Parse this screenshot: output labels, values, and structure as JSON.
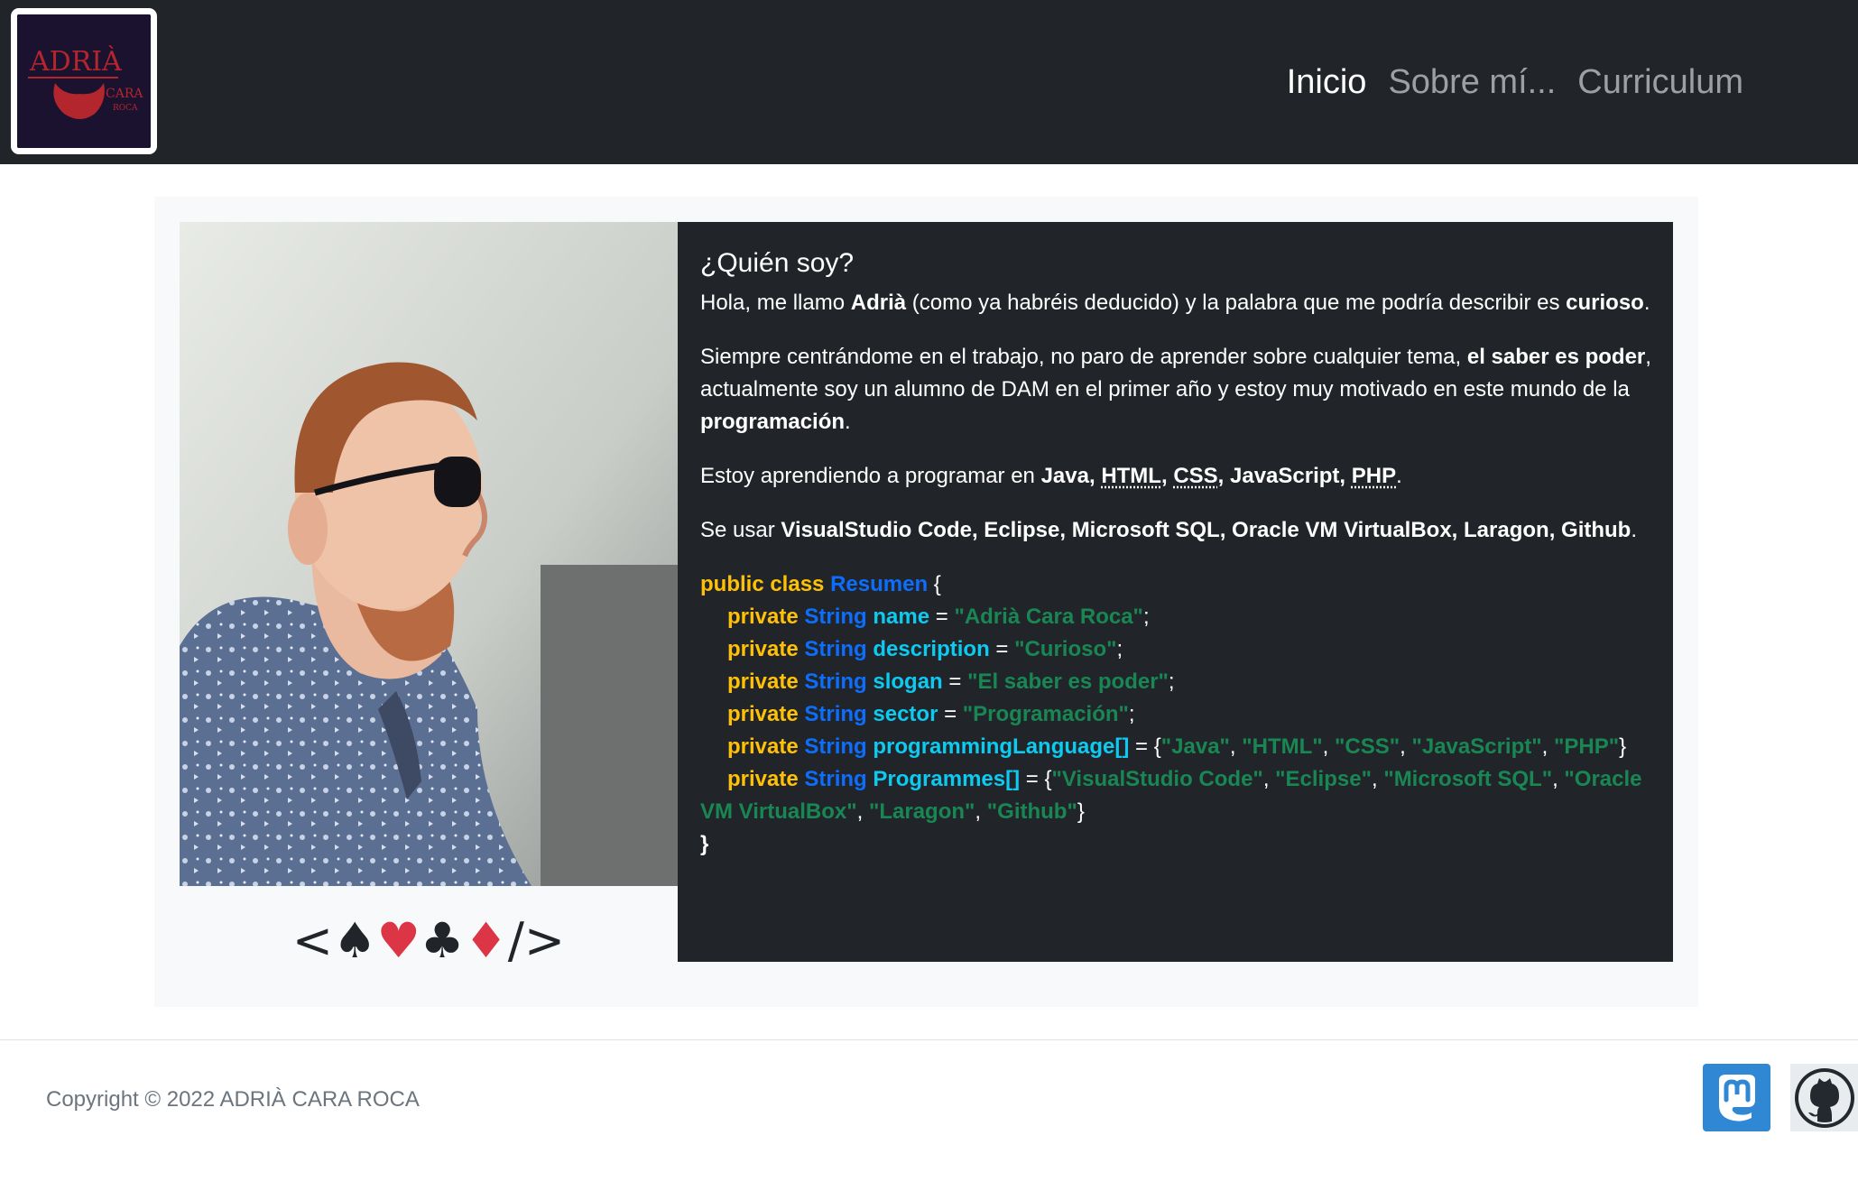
{
  "header": {
    "logo": {
      "name": "ADRIÀ",
      "sub": "CARA",
      "sub2": "ROCA",
      "alt": "Adrià Cara Roca logo"
    },
    "nav": [
      {
        "label": "Inicio",
        "active": true
      },
      {
        "label": "Sobre mí...",
        "active": false
      },
      {
        "label": "Curriculum",
        "active": false
      }
    ]
  },
  "main": {
    "photo_alt": "Adrià in profile wearing sunglasses and a patterned shirt",
    "suits": {
      "open": "<",
      "spade": "♠",
      "heart": "♥",
      "club": "♣",
      "diamond": "♦",
      "close": "/>"
    },
    "heading": "¿Quién soy?",
    "p1": {
      "a": "Hola, me llamo ",
      "name": "Adrià",
      "b": " (como ya habréis deducido) y la palabra que me podría describir es ",
      "word": "curioso",
      "c": "."
    },
    "p2": {
      "a": "Siempre centrándome en el trabajo, no paro de aprender sobre cualquier tema, ",
      "motto": "el saber es poder",
      "b": ", actualmente soy un alumno de DAM en el primer año y estoy muy motivado en este mundo de la ",
      "field": "programación",
      "c": "."
    },
    "p3": {
      "a": "Estoy aprendiendo a programar en ",
      "java": "Java",
      "html": "HTML",
      "css": "CSS",
      "js": "JavaScript",
      "php": "PHP",
      "sep": ", ",
      "end": "."
    },
    "p4": {
      "a": "Se usar ",
      "tools": "VisualStudio Code, Eclipse, Microsoft SQL, Oracle VM VirtualBox, Laragon, Github",
      "end": "."
    },
    "code": {
      "public_class": "public class",
      "class_name": "Resumen",
      "open_brace": " {",
      "private": "private",
      "type": "String",
      "eq": " = ",
      "semi": ";",
      "lb": "{",
      "rb": "}",
      "comma": ", ",
      "close_brace": "}",
      "name_field": "name",
      "name_val": "\"Adrià Cara Roca\"",
      "desc_field": "description",
      "desc_val": "\"Curioso\"",
      "slogan_field": "slogan",
      "slogan_val": "\"El saber es poder\"",
      "sector_field": "sector",
      "sector_val": "\"Programación\"",
      "lang_field": "programmingLanguage[]",
      "langs": [
        "\"Java\"",
        "\"HTML\"",
        "\"CSS\"",
        "\"JavaScript\"",
        "\"PHP\""
      ],
      "prog_field": "Programmes[]",
      "progs": [
        "\"VisualStudio Code\"",
        "\"Eclipse\"",
        "\"Microsoft SQL\"",
        "\"Oracle",
        "VM VirtualBox\"",
        "\"Laragon\"",
        "\"Github\""
      ]
    }
  },
  "footer": {
    "copyright": "Copyright © 2022 ADRIÀ CARA ROCA",
    "mastodon_icon": "mastodon-icon",
    "github_icon": "github-icon"
  },
  "colors": {
    "navbar": "#212529",
    "keyword": "#ffc107",
    "type": "#0d6efd",
    "identifier": "#0dcaf0",
    "string": "#198754",
    "suit_red": "#dc3545",
    "mastodon": "#3088d4"
  }
}
